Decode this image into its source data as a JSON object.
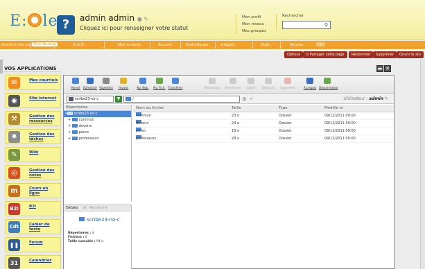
{
  "header": {
    "logo": {
      "prefix": "E",
      "suffix": "le"
    },
    "user_name": "admin admin",
    "status_prompt": "Cliquez ici pour renseigner votre statut",
    "profile_links": [
      "Mon profil",
      "Mon réseau",
      "Mes groupes"
    ],
    "search_label": "Rechercher",
    "search_value": ""
  },
  "nav": {
    "tabs": [
      "Gestion des profils",
      "Mon Bureau",
      "E.A.D.",
      "Mes e-mails",
      "Accueil",
      "Statistiques",
      "widgets",
      "Doku",
      "Ajouter"
    ],
    "active": "Mon Bureau",
    "plus": "+"
  },
  "subbar": {
    "buttons": [
      "Options",
      "Partager cette page",
      "Renommer",
      "Supprimer",
      "Ouvrir le sto"
    ]
  },
  "apps": {
    "title": "VOS APPLICATIONS",
    "items": [
      {
        "label": "Mes courriels",
        "icon": "mail-icon",
        "glyph": "✉",
        "color": "#f28c1e"
      },
      {
        "label": "Site internet",
        "icon": "globe-icon",
        "glyph": "◉",
        "color": "#555555"
      },
      {
        "label": "Gestion des ressources",
        "icon": "resources-icon",
        "glyph": "⚒",
        "color": "#b58a2e"
      },
      {
        "label": "Gestion des tâches",
        "icon": "tasks-gear-icon",
        "glyph": "✹",
        "color": "#8c8c8c"
      },
      {
        "label": "Wiki",
        "icon": "wiki-pencil-icon",
        "glyph": "✎",
        "color": "#7a9a3e"
      },
      {
        "label": "Gestion des notes",
        "icon": "notes-icon",
        "glyph": "◎",
        "color": "#d8541e"
      },
      {
        "label": "Cours en ligne",
        "icon": "courses-icon",
        "glyph": "m",
        "color": "#c86f1e"
      },
      {
        "label": "B2i",
        "icon": "b2i-icon",
        "glyph": "B2i",
        "color": "#d03a2c"
      },
      {
        "label": "Cahier de texte",
        "icon": "cdt-icon",
        "glyph": "Cdt",
        "color": "#3e7ec2"
      },
      {
        "label": "Forum",
        "icon": "forum-icon",
        "glyph": "❚❚",
        "color": "#2d5d96"
      },
      {
        "label": "Calendrier",
        "icon": "calendar-icon",
        "glyph": "31",
        "color": "#555555"
      }
    ]
  },
  "window": {
    "toolbar": [
      {
        "label": "Parent",
        "icon": "parent-folder-icon",
        "color": "#4b86d6",
        "enabled": true
      },
      {
        "label": "Rafraîchir",
        "icon": "refresh-icon",
        "color": "#3a6ec2",
        "enabled": true
      },
      {
        "label": "Vignettes",
        "icon": "thumbnails-icon",
        "color": "#8a8a8a",
        "enabled": true
      },
      {
        "label": "Favoris",
        "icon": "favorites-icon",
        "color": "#e0b22e",
        "enabled": true
      },
      {
        "label": "Nv. Rep.",
        "icon": "new-folder-icon",
        "color": "#4b86d6",
        "enabled": true
      },
      {
        "label": "Nv. Fich.",
        "icon": "new-file-icon",
        "color": "#6aa84f",
        "enabled": true
      },
      {
        "label": "Transférer",
        "icon": "upload-icon",
        "color": "#4b86d6",
        "enabled": true
      },
      {
        "label": "Télécharger",
        "icon": "download-icon",
        "color": "#8a8a8a",
        "enabled": false
      },
      {
        "label": "Renommer",
        "icon": "rename-icon",
        "color": "#8a8a8a",
        "enabled": false
      },
      {
        "label": "Copier",
        "icon": "copy-icon",
        "color": "#8a8a8a",
        "enabled": false
      },
      {
        "label": "Déplacer",
        "icon": "move-icon",
        "color": "#8a8a8a",
        "enabled": false
      },
      {
        "label": "Supprimer",
        "icon": "delete-icon",
        "color": "#d84a3a",
        "enabled": false
      },
      {
        "label": "A propos",
        "icon": "about-icon",
        "color": "#3a6ec2",
        "enabled": true
      },
      {
        "label": "Déconnexion",
        "icon": "logout-icon",
        "color": "#6aa84f",
        "enabled": true
      }
    ],
    "host": "scribe23-no-c",
    "path": "/",
    "user_prefix": "Utilisateur :",
    "user": "admin",
    "tree": {
      "header": "Répertoires",
      "root": "scribe23-no-c",
      "children": [
        "commun",
        "devoirs",
        "perso",
        "professeurs"
      ]
    },
    "details": {
      "tabs": [
        "Détails",
        "Recherche"
      ],
      "title": "scribe23-no-c",
      "folders_label": "Répertoires :",
      "folders": "4",
      "files_label": "Fichiers :",
      "files": "0",
      "size_label": "Taille cumulée :",
      "size": "94 o"
    },
    "files": {
      "columns": [
        "Nom du fichier",
        "Taille",
        "Type",
        "Modifié le"
      ],
      "rows": [
        {
          "name": "commun",
          "size": "23 o",
          "type": "Dossier",
          "modified": "09/12/2011 09:00"
        },
        {
          "name": "devoirs",
          "size": "24 o",
          "type": "Dossier",
          "modified": "09/12/2011 09:00"
        },
        {
          "name": "perso",
          "size": "19 o",
          "type": "Dossier",
          "modified": "09/12/2011 09:00"
        },
        {
          "name": "professeurs",
          "size": "28 o",
          "type": "Dossier",
          "modified": "09/12/2011 09:00"
        }
      ]
    }
  }
}
